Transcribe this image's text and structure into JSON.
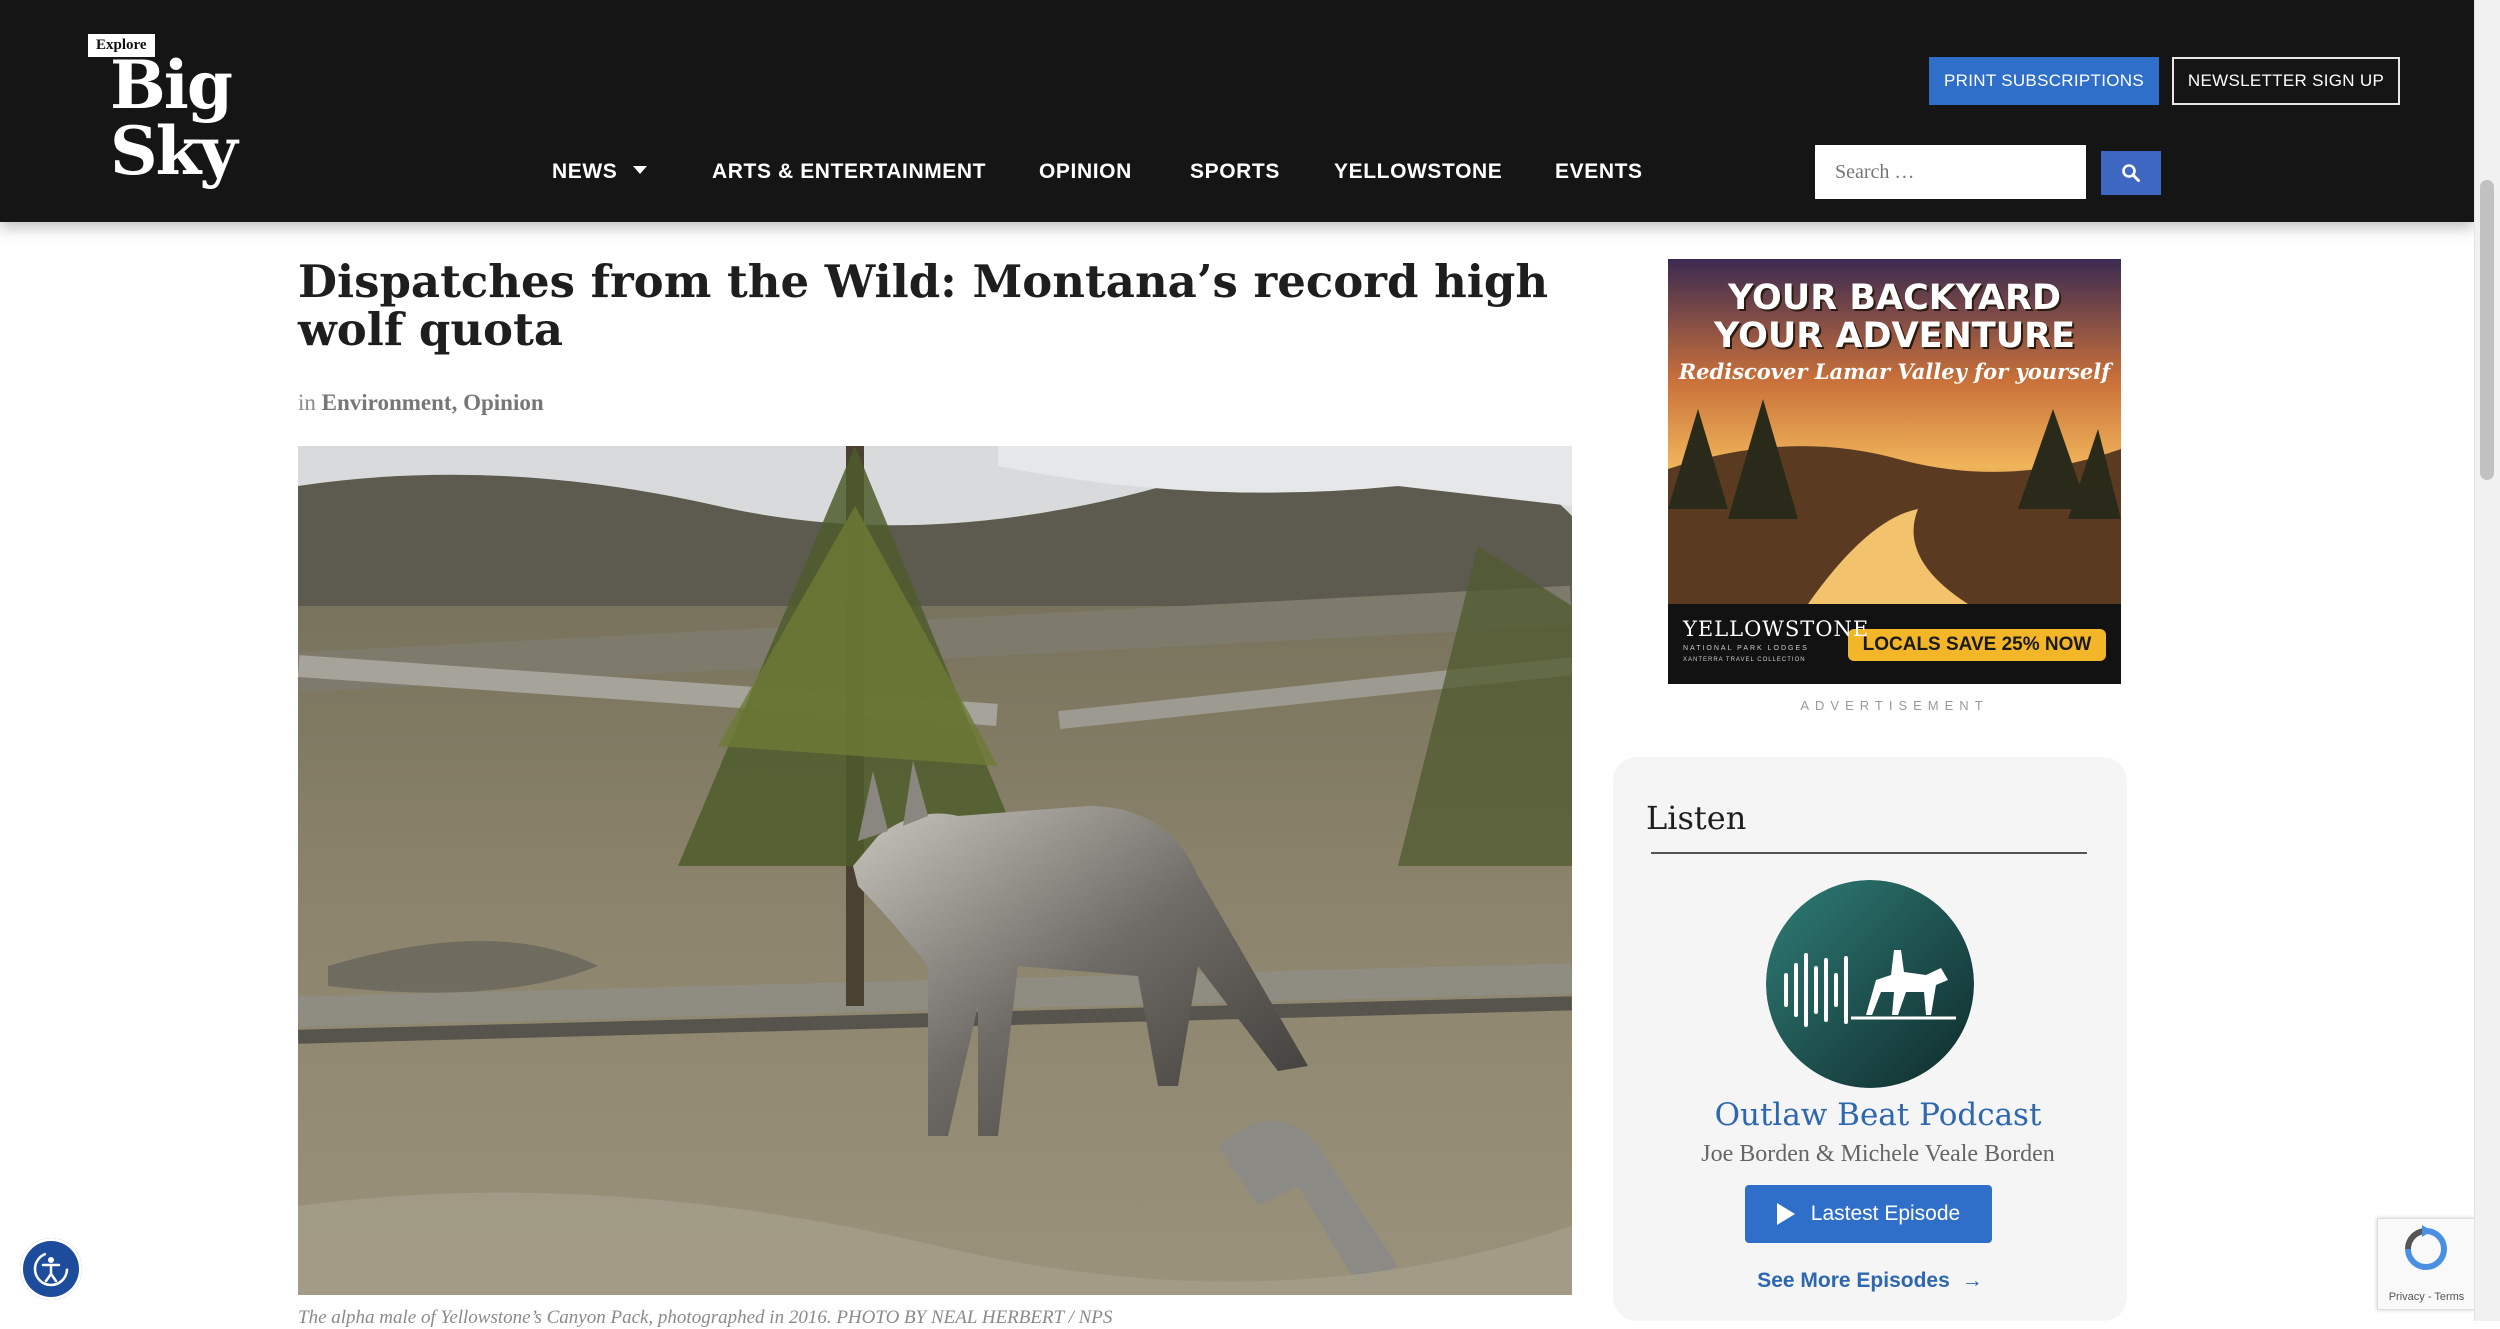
{
  "header": {
    "logo_small": "Explore",
    "logo_main": "Big Sky",
    "print_subscriptions": "PRINT SUBSCRIPTIONS",
    "newsletter_signup": "NEWSLETTER SIGN UP",
    "search_placeholder": "Search …"
  },
  "nav": {
    "items": [
      {
        "label": "NEWS"
      },
      {
        "label": "ARTS & ENTERTAINMENT"
      },
      {
        "label": "OPINION"
      },
      {
        "label": "SPORTS"
      },
      {
        "label": "YELLOWSTONE"
      },
      {
        "label": "EVENTS"
      }
    ]
  },
  "article": {
    "title": "Dispatches from the Wild: Montana’s record high wolf quota",
    "in_prefix": "in",
    "categories": [
      "Environment",
      "Opinion"
    ],
    "caption": "The alpha male of Yellowstone’s Canyon Pack, photographed in 2016. PHOTO BY NEAL HERBERT / NPS"
  },
  "ad": {
    "line1": "YOUR BACKYARD",
    "line2": "YOUR ADVENTURE",
    "tagline": "Rediscover Lamar Valley for yourself",
    "brand": "YELLOWSTONE",
    "brand_sub1": "NATIONAL PARK LODGES",
    "brand_sub2": "XANTERRA TRAVEL COLLECTION",
    "badge": "LOCALS SAVE 25% NOW",
    "label": "ADVERTISEMENT"
  },
  "listen": {
    "title": "Listen",
    "podcast_name": "Outlaw Beat Podcast",
    "hosts": "Joe Borden & Michele Veale Borden",
    "latest_button": "Lastest Episode",
    "more_link": "See More Episodes"
  },
  "recaptcha": {
    "text": "Privacy - Terms"
  },
  "colors": {
    "header_bg": "#151515",
    "accent_blue": "#2f6fc9",
    "link_blue": "#2d67b0"
  }
}
